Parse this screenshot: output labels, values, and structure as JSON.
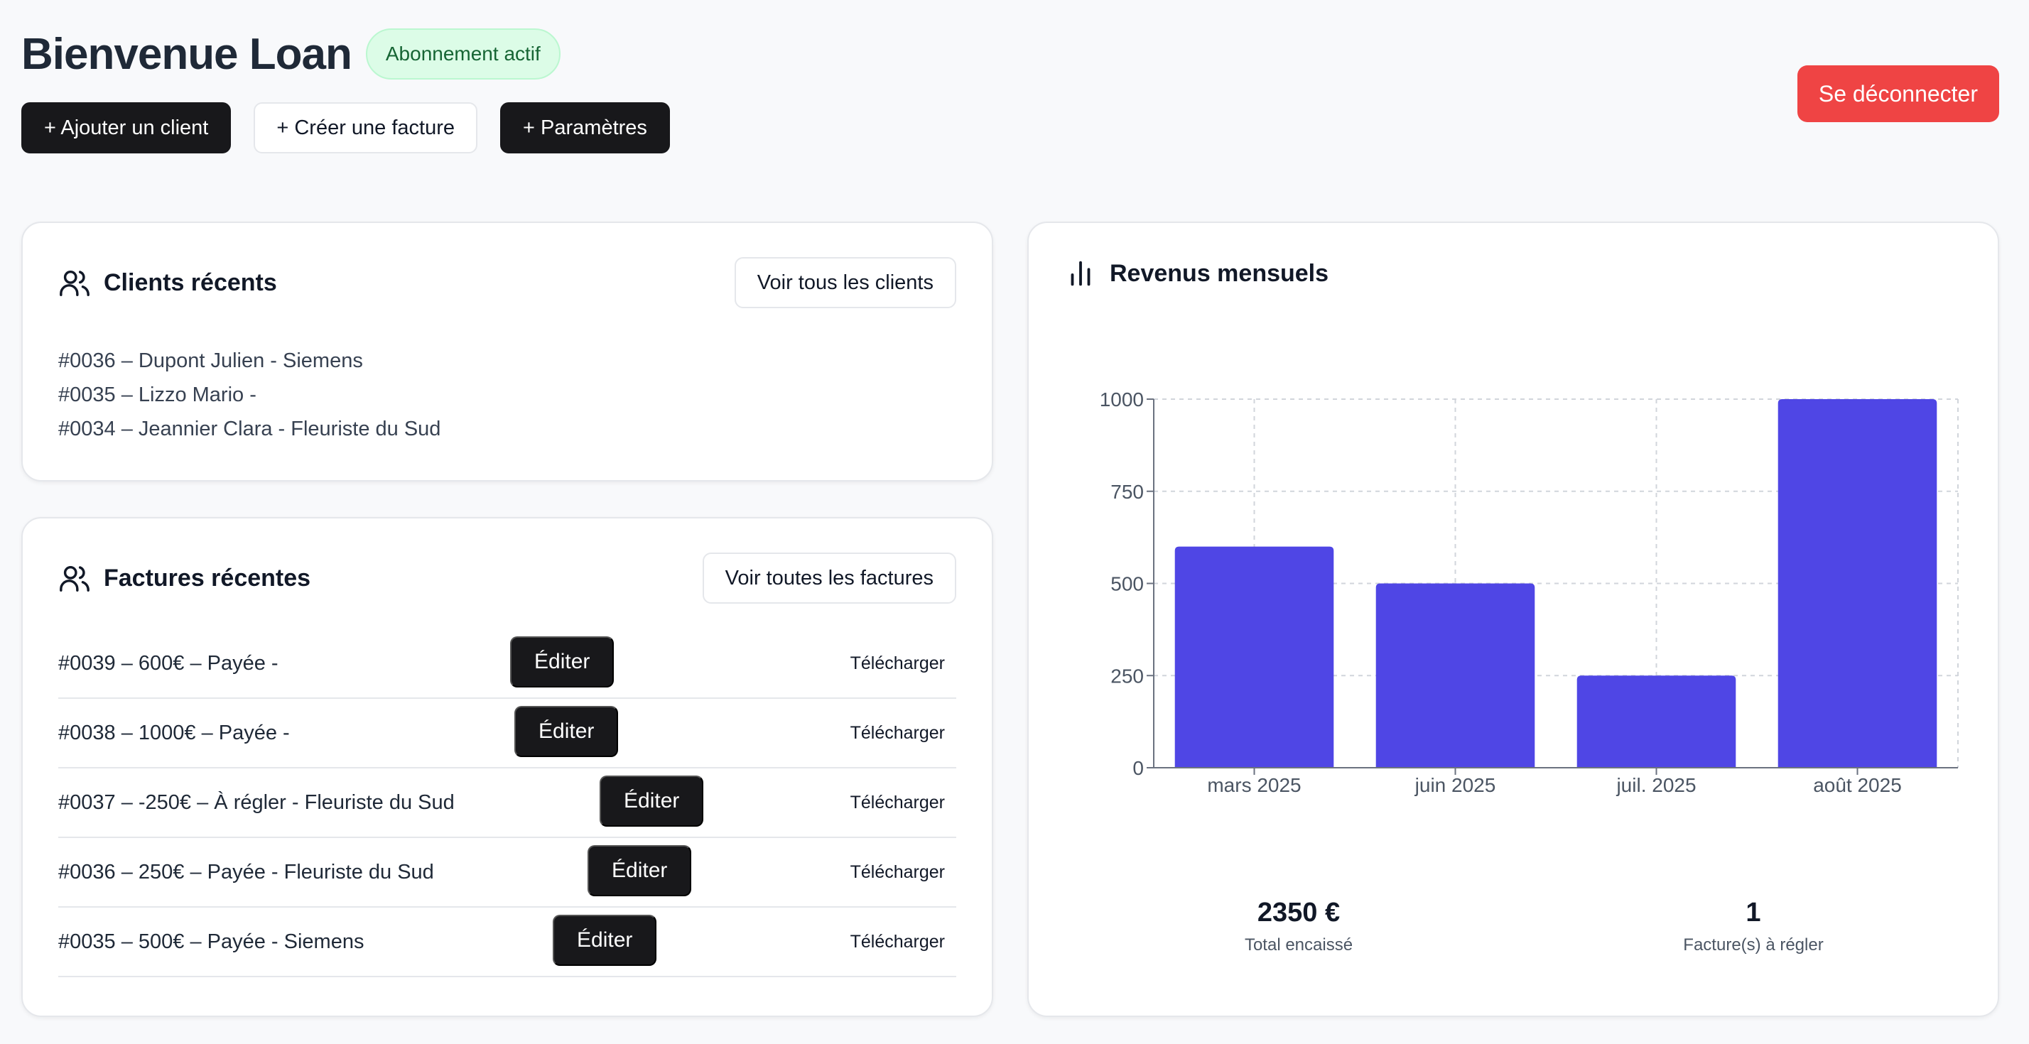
{
  "header": {
    "title": "Bienvenue Loan",
    "badge": "Abonnement actif",
    "actions": {
      "add_client": "+ Ajouter un client",
      "create_invoice": "+ Créer une facture",
      "settings": "+ Paramètres"
    },
    "logout": "Se déconnecter"
  },
  "clients": {
    "title": "Clients récents",
    "view_all": "Voir tous les clients",
    "items": [
      "#0036 – Dupont Julien - Siemens",
      "#0035 – Lizzo Mario -",
      "#0034 – Jeannier Clara - Fleuriste du Sud"
    ]
  },
  "invoices": {
    "title": "Factures récentes",
    "view_all": "Voir toutes les factures",
    "edit_label": "Éditer",
    "download_label": "Télécharger",
    "items": [
      "#0039 – 600€ – Payée -",
      "#0038 – 1000€ – Payée -",
      "#0037 – -250€ – À régler - Fleuriste du Sud",
      "#0036 – 250€ – Payée - Fleuriste du Sud",
      "#0035 – 500€ – Payée - Siemens"
    ]
  },
  "revenue": {
    "title": "Revenus mensuels",
    "total_value": "2350 €",
    "total_label": "Total encaissé",
    "due_value": "1",
    "due_label": "Facture(s) à régler"
  },
  "colors": {
    "bar": "#4f46e5",
    "logout": "#ef4444",
    "badge_bg": "#dcfce7",
    "badge_text": "#166534"
  },
  "chart_data": {
    "type": "bar",
    "categories": [
      "mars 2025",
      "juin 2025",
      "juil. 2025",
      "août 2025"
    ],
    "values": [
      600,
      500,
      250,
      1000
    ],
    "ylim": [
      0,
      1000
    ],
    "yticks": [
      0,
      250,
      500,
      750,
      1000
    ],
    "grid": true,
    "title": "Revenus mensuels",
    "xlabel": "",
    "ylabel": ""
  }
}
